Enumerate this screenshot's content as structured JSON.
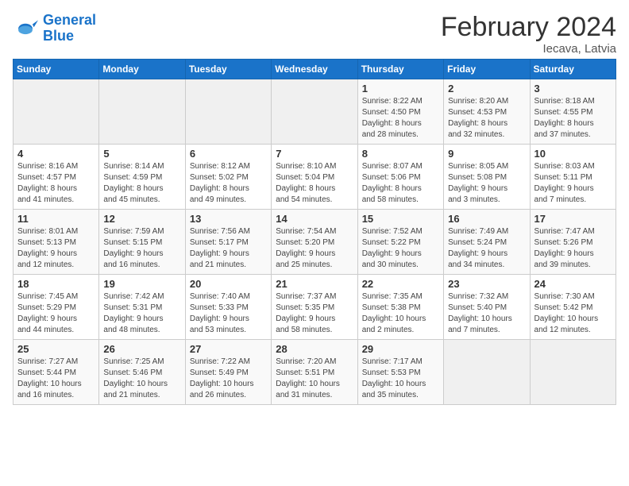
{
  "logo": {
    "line1": "General",
    "line2": "Blue"
  },
  "title": "February 2024",
  "subtitle": "Iecava, Latvia",
  "headers": [
    "Sunday",
    "Monday",
    "Tuesday",
    "Wednesday",
    "Thursday",
    "Friday",
    "Saturday"
  ],
  "weeks": [
    [
      {
        "day": "",
        "sunrise": "",
        "sunset": "",
        "daylight": ""
      },
      {
        "day": "",
        "sunrise": "",
        "sunset": "",
        "daylight": ""
      },
      {
        "day": "",
        "sunrise": "",
        "sunset": "",
        "daylight": ""
      },
      {
        "day": "",
        "sunrise": "",
        "sunset": "",
        "daylight": ""
      },
      {
        "day": "1",
        "sunrise": "Sunrise: 8:22 AM",
        "sunset": "Sunset: 4:50 PM",
        "daylight": "Daylight: 8 hours and 28 minutes."
      },
      {
        "day": "2",
        "sunrise": "Sunrise: 8:20 AM",
        "sunset": "Sunset: 4:53 PM",
        "daylight": "Daylight: 8 hours and 32 minutes."
      },
      {
        "day": "3",
        "sunrise": "Sunrise: 8:18 AM",
        "sunset": "Sunset: 4:55 PM",
        "daylight": "Daylight: 8 hours and 37 minutes."
      }
    ],
    [
      {
        "day": "4",
        "sunrise": "Sunrise: 8:16 AM",
        "sunset": "Sunset: 4:57 PM",
        "daylight": "Daylight: 8 hours and 41 minutes."
      },
      {
        "day": "5",
        "sunrise": "Sunrise: 8:14 AM",
        "sunset": "Sunset: 4:59 PM",
        "daylight": "Daylight: 8 hours and 45 minutes."
      },
      {
        "day": "6",
        "sunrise": "Sunrise: 8:12 AM",
        "sunset": "Sunset: 5:02 PM",
        "daylight": "Daylight: 8 hours and 49 minutes."
      },
      {
        "day": "7",
        "sunrise": "Sunrise: 8:10 AM",
        "sunset": "Sunset: 5:04 PM",
        "daylight": "Daylight: 8 hours and 54 minutes."
      },
      {
        "day": "8",
        "sunrise": "Sunrise: 8:07 AM",
        "sunset": "Sunset: 5:06 PM",
        "daylight": "Daylight: 8 hours and 58 minutes."
      },
      {
        "day": "9",
        "sunrise": "Sunrise: 8:05 AM",
        "sunset": "Sunset: 5:08 PM",
        "daylight": "Daylight: 9 hours and 3 minutes."
      },
      {
        "day": "10",
        "sunrise": "Sunrise: 8:03 AM",
        "sunset": "Sunset: 5:11 PM",
        "daylight": "Daylight: 9 hours and 7 minutes."
      }
    ],
    [
      {
        "day": "11",
        "sunrise": "Sunrise: 8:01 AM",
        "sunset": "Sunset: 5:13 PM",
        "daylight": "Daylight: 9 hours and 12 minutes."
      },
      {
        "day": "12",
        "sunrise": "Sunrise: 7:59 AM",
        "sunset": "Sunset: 5:15 PM",
        "daylight": "Daylight: 9 hours and 16 minutes."
      },
      {
        "day": "13",
        "sunrise": "Sunrise: 7:56 AM",
        "sunset": "Sunset: 5:17 PM",
        "daylight": "Daylight: 9 hours and 21 minutes."
      },
      {
        "day": "14",
        "sunrise": "Sunrise: 7:54 AM",
        "sunset": "Sunset: 5:20 PM",
        "daylight": "Daylight: 9 hours and 25 minutes."
      },
      {
        "day": "15",
        "sunrise": "Sunrise: 7:52 AM",
        "sunset": "Sunset: 5:22 PM",
        "daylight": "Daylight: 9 hours and 30 minutes."
      },
      {
        "day": "16",
        "sunrise": "Sunrise: 7:49 AM",
        "sunset": "Sunset: 5:24 PM",
        "daylight": "Daylight: 9 hours and 34 minutes."
      },
      {
        "day": "17",
        "sunrise": "Sunrise: 7:47 AM",
        "sunset": "Sunset: 5:26 PM",
        "daylight": "Daylight: 9 hours and 39 minutes."
      }
    ],
    [
      {
        "day": "18",
        "sunrise": "Sunrise: 7:45 AM",
        "sunset": "Sunset: 5:29 PM",
        "daylight": "Daylight: 9 hours and 44 minutes."
      },
      {
        "day": "19",
        "sunrise": "Sunrise: 7:42 AM",
        "sunset": "Sunset: 5:31 PM",
        "daylight": "Daylight: 9 hours and 48 minutes."
      },
      {
        "day": "20",
        "sunrise": "Sunrise: 7:40 AM",
        "sunset": "Sunset: 5:33 PM",
        "daylight": "Daylight: 9 hours and 53 minutes."
      },
      {
        "day": "21",
        "sunrise": "Sunrise: 7:37 AM",
        "sunset": "Sunset: 5:35 PM",
        "daylight": "Daylight: 9 hours and 58 minutes."
      },
      {
        "day": "22",
        "sunrise": "Sunrise: 7:35 AM",
        "sunset": "Sunset: 5:38 PM",
        "daylight": "Daylight: 10 hours and 2 minutes."
      },
      {
        "day": "23",
        "sunrise": "Sunrise: 7:32 AM",
        "sunset": "Sunset: 5:40 PM",
        "daylight": "Daylight: 10 hours and 7 minutes."
      },
      {
        "day": "24",
        "sunrise": "Sunrise: 7:30 AM",
        "sunset": "Sunset: 5:42 PM",
        "daylight": "Daylight: 10 hours and 12 minutes."
      }
    ],
    [
      {
        "day": "25",
        "sunrise": "Sunrise: 7:27 AM",
        "sunset": "Sunset: 5:44 PM",
        "daylight": "Daylight: 10 hours and 16 minutes."
      },
      {
        "day": "26",
        "sunrise": "Sunrise: 7:25 AM",
        "sunset": "Sunset: 5:46 PM",
        "daylight": "Daylight: 10 hours and 21 minutes."
      },
      {
        "day": "27",
        "sunrise": "Sunrise: 7:22 AM",
        "sunset": "Sunset: 5:49 PM",
        "daylight": "Daylight: 10 hours and 26 minutes."
      },
      {
        "day": "28",
        "sunrise": "Sunrise: 7:20 AM",
        "sunset": "Sunset: 5:51 PM",
        "daylight": "Daylight: 10 hours and 31 minutes."
      },
      {
        "day": "29",
        "sunrise": "Sunrise: 7:17 AM",
        "sunset": "Sunset: 5:53 PM",
        "daylight": "Daylight: 10 hours and 35 minutes."
      },
      {
        "day": "",
        "sunrise": "",
        "sunset": "",
        "daylight": ""
      },
      {
        "day": "",
        "sunrise": "",
        "sunset": "",
        "daylight": ""
      }
    ]
  ]
}
